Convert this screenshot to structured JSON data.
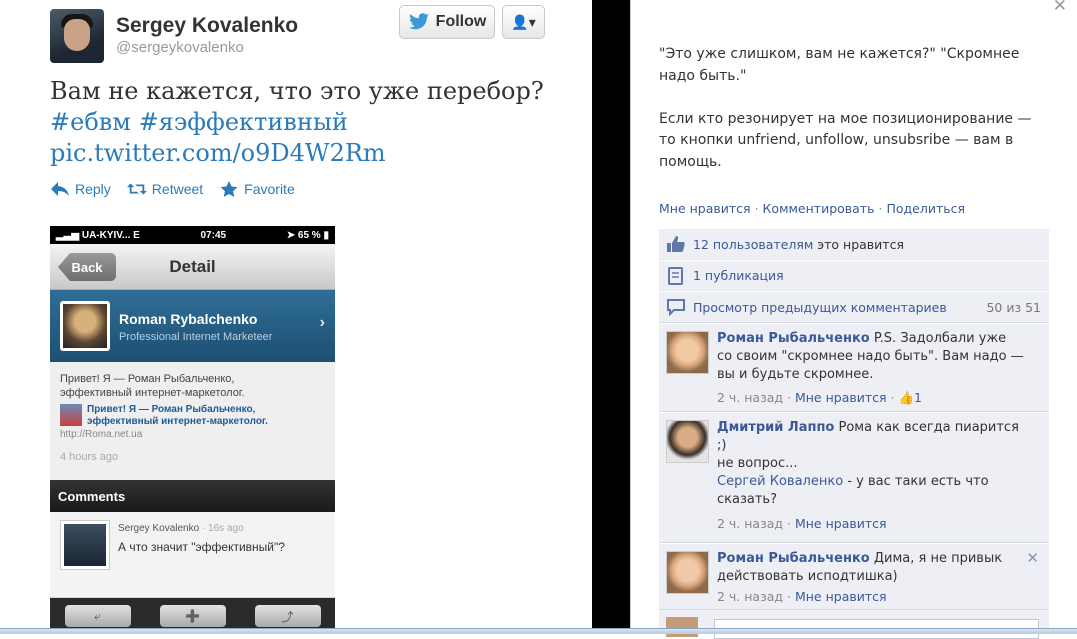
{
  "tweet": {
    "name": "Sergey Kovalenko",
    "handle": "@sergeykovalenko",
    "follow_label": "Follow",
    "text_line1": "Вам не кажется, что это уже перебор?",
    "hashtags": "#ебвм #яэффективный",
    "link": "pic.twitter.com/o9D4W2Rm",
    "actions": {
      "reply": "Reply",
      "retweet": "Retweet",
      "favorite": "Favorite"
    }
  },
  "phone": {
    "status": {
      "carrier": "UA-KYIV...",
      "network": "E",
      "time": "07:45",
      "battery": "65 %"
    },
    "back_label": "Back",
    "title": "Detail",
    "profile": {
      "name": "Roman Rybalchenko",
      "role": "Professional Internet Marketeer"
    },
    "post": {
      "line1": "Привет! Я — Роман Рыбальченко,",
      "line2": "эффективный интернет-маркетолог.",
      "shared_line1": "Привет! Я — Роман Рыбальченко,",
      "shared_line2": "эффективный интернет-маркетолог.",
      "shared_url": "http://Roma.net.ua",
      "ago": "4 hours ago"
    },
    "comments_header": "Comments",
    "comment": {
      "author": "Sergey Kovalenko",
      "time": "· 16s ago",
      "text": "А что значит \"эффективный\"?"
    }
  },
  "fb": {
    "post_p1_line1": "\"Это уже слишком, вам не кажется?\" \"Скромнее",
    "post_p1_line2": "надо быть.\"",
    "post_p2_line1": "Если кто резонирует на мое позиционирование —",
    "post_p2_line2": "то кнопки unfriend, unfollow, unsubsribe — вам в",
    "post_p2_line3": "помощь.",
    "actions": {
      "like": "Мне нравится",
      "comment": "Комментировать",
      "share": "Поделиться"
    },
    "likes": {
      "count_text": "12 пользователям",
      "suffix": "это нравится"
    },
    "shares": "1 публикация",
    "prev_comments": {
      "label": "Просмотр предыдущих комментариев",
      "count": "50 из 51"
    },
    "comments": [
      {
        "author": "Роман Рыбальченко",
        "text_line1": "P.S. Задолбали уже",
        "text_line2": "со своим \"скромнее надо быть\". Вам надо —",
        "text_line3": "вы и будьте скромнее.",
        "time": "2 ч. назад",
        "like": "Мне нравится",
        "likes_count": "1"
      },
      {
        "author": "Дмитрий Лаппо",
        "text_line1": "Рома как всегда пиарится",
        "text_line2": ";)",
        "text_line3": "не вопрос...",
        "mention": "Сергей Коваленко",
        "text_line4": "- у вас таки есть что",
        "text_line5": "сказать?",
        "time": "2 ч. назад",
        "like": "Мне нравится"
      },
      {
        "author": "Роман Рыбальченко",
        "text_line1": "Дима, я не привык",
        "text_line2": "действовать исподтишка)",
        "time": "2 ч. назад",
        "like": "Мне нравится"
      }
    ]
  },
  "colors": {
    "twitter_link": "#2b7bb9",
    "fb_blue": "#3b5998",
    "fb_bg": "#edeff4"
  }
}
